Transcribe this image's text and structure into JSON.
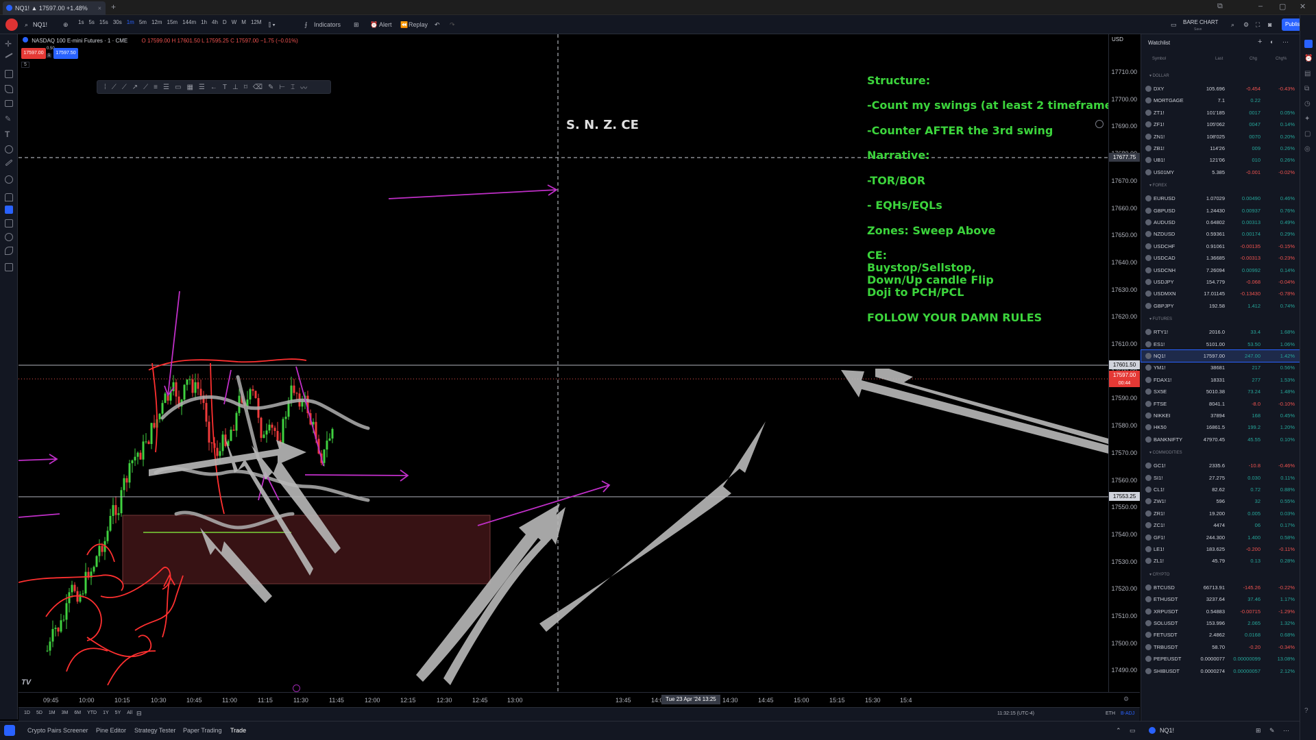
{
  "tab": {
    "title": "NQ1! ▲ 17597.00 +1.48%",
    "new_tab": "+"
  },
  "toolbar": {
    "symbol": "NQ1!",
    "intervals": [
      "1s",
      "5s",
      "15s",
      "30s",
      "1m",
      "5m",
      "12m",
      "15m",
      "144m",
      "1h",
      "4h",
      "D",
      "W",
      "M",
      "12M"
    ],
    "indicators": "Indicators",
    "alert": "Alert",
    "replay": "Replay",
    "layout_name": "BARE CHART",
    "layout_sub": "Save",
    "publish": "Publish"
  },
  "legend": {
    "title": "NASDAQ 100 E-mini Futures · 1 · CME",
    "ohlc": "O 17599.00  H 17601.50  L 17595.25  C 17597.00  −1.75 (−0.01%)",
    "sell": "17597.00",
    "spread": "0.50",
    "buy": "17597.50",
    "qty": "1",
    "counter": "5"
  },
  "price_labels": [
    "17710.00",
    "17700.00",
    "17690.00",
    "17680.00",
    "17670.00",
    "17660.00",
    "17650.00",
    "17640.00",
    "17630.00",
    "17620.00",
    "17610.00",
    "17600.00",
    "17590.00",
    "17580.00",
    "17570.00",
    "17560.00",
    "17550.00",
    "17540.00",
    "17530.00",
    "17520.00",
    "17510.00",
    "17500.00",
    "17490.00"
  ],
  "price_tags": {
    "crosshair": "17677.75",
    "upper_line": "17601.50",
    "last": "17597.00",
    "countdown": "00:44",
    "lower_line": "17553.25",
    "currency": "USD"
  },
  "time_labels": [
    "09:45",
    "10:00",
    "10:15",
    "10:30",
    "10:45",
    "11:00",
    "11:15",
    "11:30",
    "11:45",
    "12:00",
    "12:15",
    "12:30",
    "12:45",
    "13:00",
    "13:45",
    "14:00",
    "14:15",
    "14:30",
    "14:45",
    "15:00",
    "15:15",
    "15:30",
    "15:4"
  ],
  "time_cursor": "Tue 23 Apr '24   13:25",
  "annotation": "S. N. Z. CE",
  "notes": [
    "Structure:",
    "-Count my swings (at least 2 timeframes)",
    "-Counter AFTER the 3rd swing",
    "Narrative:",
    "-TOR/BOR",
    "- EQHs/EQLs",
    "Zones: Sweep Above",
    "CE:",
    "Buystop/Sellstop,",
    "Down/Up candle Flip",
    "Doji to PCH/PCL",
    "FOLLOW YOUR DAMN RULES"
  ],
  "ranges": {
    "items": [
      "1D",
      "5D",
      "1M",
      "3M",
      "6M",
      "YTD",
      "1Y",
      "5Y",
      "All"
    ],
    "clock": "11:32:15 (UTC-4)",
    "session": "ETH",
    "adj": "B-ADJ"
  },
  "footer": {
    "tabs": [
      "Crypto Pairs Screener",
      "Pine Editor",
      "Strategy Tester",
      "Paper Trading",
      "Trade"
    ],
    "symbol": "NQ1!"
  },
  "watchlist": {
    "title": "Watchlist",
    "cols": [
      "Symbol",
      "Last",
      "Chg",
      "Chg%"
    ],
    "sections": [
      {
        "name": "DOLLAR",
        "rows": [
          [
            "DXY",
            "105.696",
            "-0.454",
            "-0.43%",
            "d"
          ],
          [
            "MORTGAGE",
            "7.1",
            "0.22",
            "",
            "u"
          ],
          [
            "ZT1!",
            "101'185",
            "0017",
            "0.05%",
            "u"
          ],
          [
            "ZF1!",
            "105'062",
            "0047",
            "0.14%",
            "u"
          ],
          [
            "ZN1!",
            "108'025",
            "0070",
            "0.20%",
            "u"
          ],
          [
            "ZB1!",
            "114'26",
            "009",
            "0.26%",
            "u"
          ],
          [
            "UB1!",
            "121'06",
            "010",
            "0.26%",
            "u"
          ],
          [
            "US01MY",
            "5.385",
            "-0.001",
            "-0.02%",
            "d"
          ]
        ]
      },
      {
        "name": "FOREX",
        "rows": [
          [
            "EURUSD",
            "1.07029",
            "0.00490",
            "0.46%",
            "u"
          ],
          [
            "GBPUSD",
            "1.24430",
            "0.00937",
            "0.76%",
            "u"
          ],
          [
            "AUDUSD",
            "0.64802",
            "0.00313",
            "0.49%",
            "u"
          ],
          [
            "NZDUSD",
            "0.59361",
            "0.00174",
            "0.29%",
            "u"
          ],
          [
            "USDCHF",
            "0.91061",
            "-0.00135",
            "-0.15%",
            "d"
          ],
          [
            "USDCAD",
            "1.36685",
            "-0.00313",
            "-0.23%",
            "d"
          ],
          [
            "USDCNH",
            "7.26094",
            "0.00992",
            "0.14%",
            "u"
          ],
          [
            "USDJPY",
            "154.779",
            "-0.068",
            "-0.04%",
            "d"
          ],
          [
            "USDMXN",
            "17.01145",
            "-0.13430",
            "-0.78%",
            "d"
          ],
          [
            "GBPJPY",
            "192.58",
            "1.412",
            "0.74%",
            "u"
          ]
        ]
      },
      {
        "name": "FUTURES",
        "rows": [
          [
            "RTY1!",
            "2016.0",
            "33.4",
            "1.68%",
            "u"
          ],
          [
            "ES1!",
            "5101.00",
            "53.50",
            "1.06%",
            "u"
          ],
          [
            "NQ1!",
            "17597.00",
            "247.00",
            "1.42%",
            "u"
          ],
          [
            "YM1!",
            "38681",
            "217",
            "0.56%",
            "u"
          ],
          [
            "FDAX1!",
            "18331",
            "277",
            "1.53%",
            "u"
          ],
          [
            "SX5E",
            "5010.38",
            "73.24",
            "1.48%",
            "u"
          ],
          [
            "FTSE",
            "8041.1",
            "-8.0",
            "-0.10%",
            "d"
          ],
          [
            "NIKKEI",
            "37894",
            "168",
            "0.45%",
            "u"
          ],
          [
            "HK50",
            "16861.5",
            "199.2",
            "1.20%",
            "u"
          ],
          [
            "BANKNIFTY",
            "47970.45",
            "45.55",
            "0.10%",
            "u"
          ]
        ]
      },
      {
        "name": "COMMODITIES",
        "rows": [
          [
            "GC1!",
            "2335.6",
            "-10.8",
            "-0.46%",
            "d"
          ],
          [
            "SI1!",
            "27.275",
            "0.030",
            "0.11%",
            "u"
          ],
          [
            "CL1!",
            "82.62",
            "0.72",
            "0.88%",
            "u"
          ],
          [
            "ZW1!",
            "596",
            "32",
            "0.55%",
            "u"
          ],
          [
            "ZR1!",
            "19.200",
            "0.005",
            "0.03%",
            "u"
          ],
          [
            "ZC1!",
            "4474",
            "06",
            "0.17%",
            "u"
          ],
          [
            "GF1!",
            "244.300",
            "1.400",
            "0.58%",
            "u"
          ],
          [
            "LE1!",
            "183.625",
            "-0.200",
            "-0.11%",
            "d"
          ],
          [
            "ZL1!",
            "45.79",
            "0.13",
            "0.28%",
            "u"
          ]
        ]
      },
      {
        "name": "CRYPTO",
        "rows": [
          [
            "BTCUSD",
            "66713.91",
            "-145.26",
            "-0.22%",
            "d"
          ],
          [
            "ETHUSDT",
            "3237.64",
            "37.46",
            "1.17%",
            "u"
          ],
          [
            "XRPUSDT",
            "0.54883",
            "-0.00715",
            "-1.29%",
            "d"
          ],
          [
            "SOLUSDT",
            "153.996",
            "2.065",
            "1.32%",
            "u"
          ],
          [
            "FETUSDT",
            "2.4862",
            "0.0168",
            "0.68%",
            "u"
          ],
          [
            "TRBUSDT",
            "58.70",
            "-0.20",
            "-0.34%",
            "d"
          ],
          [
            "PEPEUSDT",
            "0.0000077",
            "0.00000099",
            "13.08%",
            "u"
          ],
          [
            "SHIBUSDT",
            "0.0000274",
            "0.00000057",
            "2.12%",
            "u"
          ]
        ]
      }
    ]
  },
  "colors": {
    "up": "#26a69a",
    "down": "#ef5350",
    "notes": "#3cd43c",
    "magenta": "#c02fc8",
    "accent": "#2962ff"
  }
}
